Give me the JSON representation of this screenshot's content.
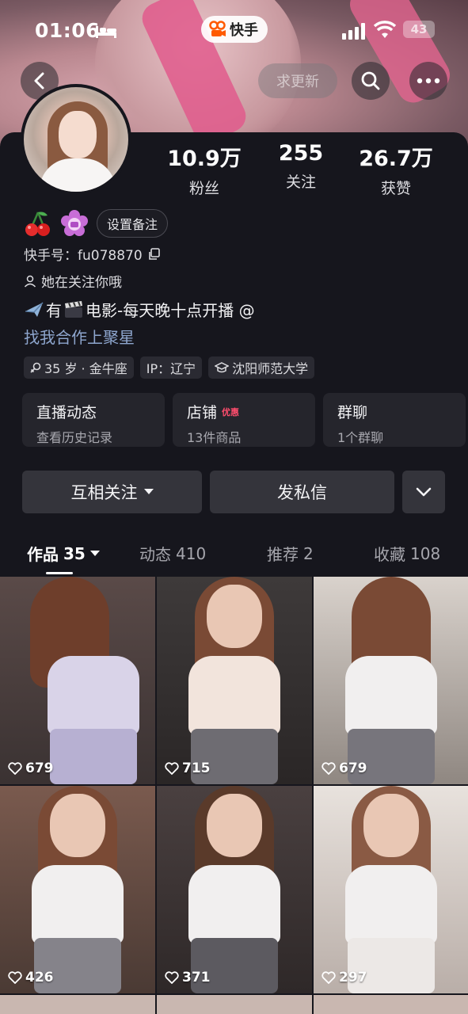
{
  "status_bar": {
    "time": "01:06",
    "app_name": "快手",
    "battery": "43"
  },
  "header": {
    "update_label": "求更新"
  },
  "stats": [
    {
      "value": "10.9万",
      "label": "粉丝"
    },
    {
      "value": "255",
      "label": "关注"
    },
    {
      "value": "26.7万",
      "label": "获赞"
    }
  ],
  "profile": {
    "remark_label": "设置备注",
    "kuaishou_id": "快手号：fu078870",
    "follow_hint": "她在关注你哦",
    "bio_prefix": "有",
    "bio_text": "电影-每天晚十点开播 @",
    "link_text": "找我合作上聚星",
    "tags": [
      "35 岁 · 金牛座",
      "IP：辽宁",
      "沈阳师范大学"
    ]
  },
  "cards": [
    {
      "title": "直播动态",
      "subtitle": "查看历史记录",
      "promo": ""
    },
    {
      "title": "店铺",
      "subtitle": "13件商品",
      "promo": "优惠"
    },
    {
      "title": "群聊",
      "subtitle": "1个群聊",
      "promo": ""
    }
  ],
  "actions": {
    "mutual_follow": "互相关注",
    "message": "发私信"
  },
  "tabs": [
    {
      "label": "作品",
      "count": "35"
    },
    {
      "label": "动态",
      "count": "410"
    },
    {
      "label": "推荐",
      "count": "2"
    },
    {
      "label": "收藏",
      "count": "108"
    }
  ],
  "videos": [
    {
      "likes": "679"
    },
    {
      "likes": "715"
    },
    {
      "likes": "679"
    },
    {
      "likes": "426"
    },
    {
      "likes": "371"
    },
    {
      "likes": "297"
    }
  ],
  "colors": {
    "background": "#16161d",
    "card": "#25252c",
    "link": "#8ea6ce",
    "promo": "#ff4d6d"
  }
}
